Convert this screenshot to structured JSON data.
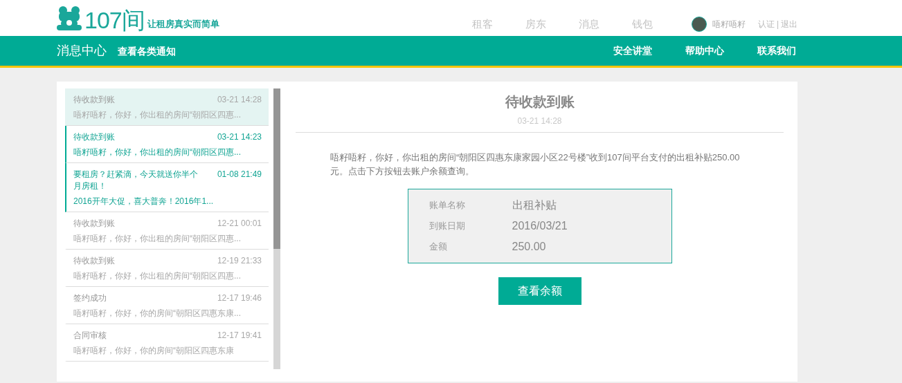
{
  "header": {
    "logo": {
      "brand": "107间",
      "slogan": "让租房真实而简单"
    },
    "nav": [
      {
        "label": "租客"
      },
      {
        "label": "房东"
      },
      {
        "label": "消息"
      },
      {
        "label": "钱包"
      }
    ],
    "user": {
      "name": "唔籽唔籽",
      "links": [
        "认证",
        "|",
        "退出"
      ]
    }
  },
  "subbar": {
    "title": "消息中心",
    "subtitle": "查看各类通知",
    "links": [
      "安全讲堂",
      "帮助中心",
      "联系我们"
    ]
  },
  "messages": [
    {
      "title": "待收款到账",
      "time": "03-21 14:28",
      "preview": "唔籽唔籽，你好，你出租的房间“朝阳区四惠...",
      "selected": true,
      "unread": false
    },
    {
      "title": "待收款到账",
      "time": "03-21 14:23",
      "preview": "唔籽唔籽，你好，你出租的房间“朝阳区四惠...",
      "selected": false,
      "unread": true
    },
    {
      "title": "要租房？赶紧滴，今天就送你半个月房租！",
      "time": "01-08 21:49",
      "preview": "2016开年大促，喜大普奔！2016年1...",
      "selected": false,
      "unread": true
    },
    {
      "title": "待收款到账",
      "time": "12-21 00:01",
      "preview": "唔籽唔籽，你好，你出租的房间“朝阳区四惠...",
      "selected": false,
      "unread": false
    },
    {
      "title": "待收款到账",
      "time": "12-19 21:33",
      "preview": "唔籽唔籽，你好，你出租的房间“朝阳区四惠...",
      "selected": false,
      "unread": false
    },
    {
      "title": "签约成功",
      "time": "12-17 19:46",
      "preview": "唔籽唔籽，你好，你的房间“朝阳区四惠东康...",
      "selected": false,
      "unread": false
    },
    {
      "title": "合同审核",
      "time": "12-17 19:41",
      "preview": "唔籽唔籽，你好，你的房间“朝阳区四惠东康",
      "selected": false,
      "unread": false
    }
  ],
  "detail": {
    "title": "待收款到账",
    "time": "03-21 14:28",
    "body": "唔籽唔籽，你好，你出租的房间“朝阳区四惠东康家园小区22号楼”收到107间平台支付的出租补贴250.00元。点击下方按钮去账户余额查询。",
    "fields": [
      {
        "label": "账单名称",
        "value": "出租补贴"
      },
      {
        "label": "到账日期",
        "value": "2016/03/21"
      },
      {
        "label": "金额",
        "value": "250.00"
      }
    ],
    "button": "查看余额"
  }
}
